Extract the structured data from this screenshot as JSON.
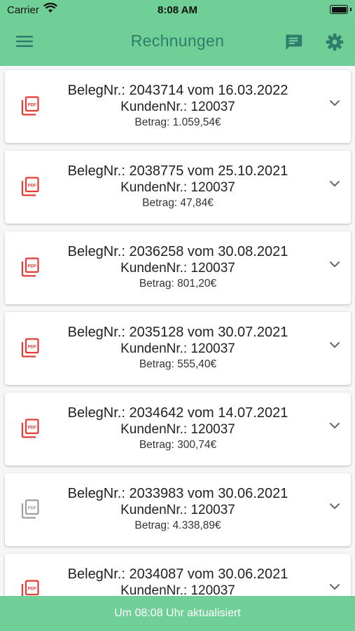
{
  "status_bar": {
    "carrier": "Carrier",
    "time": "8:08 AM"
  },
  "header": {
    "title": "Rechnungen",
    "menu_icon": "menu-icon",
    "chat_icon": "chat-icon",
    "settings_icon": "gear-icon"
  },
  "colors": {
    "accent": "#6fcf97",
    "title": "#2e7d6b",
    "pdf_red": "#e53935",
    "pdf_grey": "#9e9e9e"
  },
  "invoices": [
    {
      "title": "BelegNr.: 2043714 vom 16.03.2022",
      "customer": "KundenNr.: 120037",
      "amount": "Betrag: 1.059,54€",
      "icon_state": "red"
    },
    {
      "title": "BelegNr.: 2038775 vom 25.10.2021",
      "customer": "KundenNr.: 120037",
      "amount": "Betrag: 47,84€",
      "icon_state": "red"
    },
    {
      "title": "BelegNr.: 2036258 vom 30.08.2021",
      "customer": "KundenNr.: 120037",
      "amount": "Betrag: 801,20€",
      "icon_state": "red"
    },
    {
      "title": "BelegNr.: 2035128 vom 30.07.2021",
      "customer": "KundenNr.: 120037",
      "amount": "Betrag: 555,40€",
      "icon_state": "red"
    },
    {
      "title": "BelegNr.: 2034642 vom 14.07.2021",
      "customer": "KundenNr.: 120037",
      "amount": "Betrag: 300,74€",
      "icon_state": "red"
    },
    {
      "title": "BelegNr.: 2033983 vom 30.06.2021",
      "customer": "KundenNr.: 120037",
      "amount": "Betrag: 4.338,89€",
      "icon_state": "grey"
    },
    {
      "title": "BelegNr.: 2034087 vom 30.06.2021",
      "customer": "KundenNr.: 120037",
      "amount": "",
      "icon_state": "red"
    }
  ],
  "footer": {
    "text": "Um 08:08 Uhr aktualisiert"
  }
}
